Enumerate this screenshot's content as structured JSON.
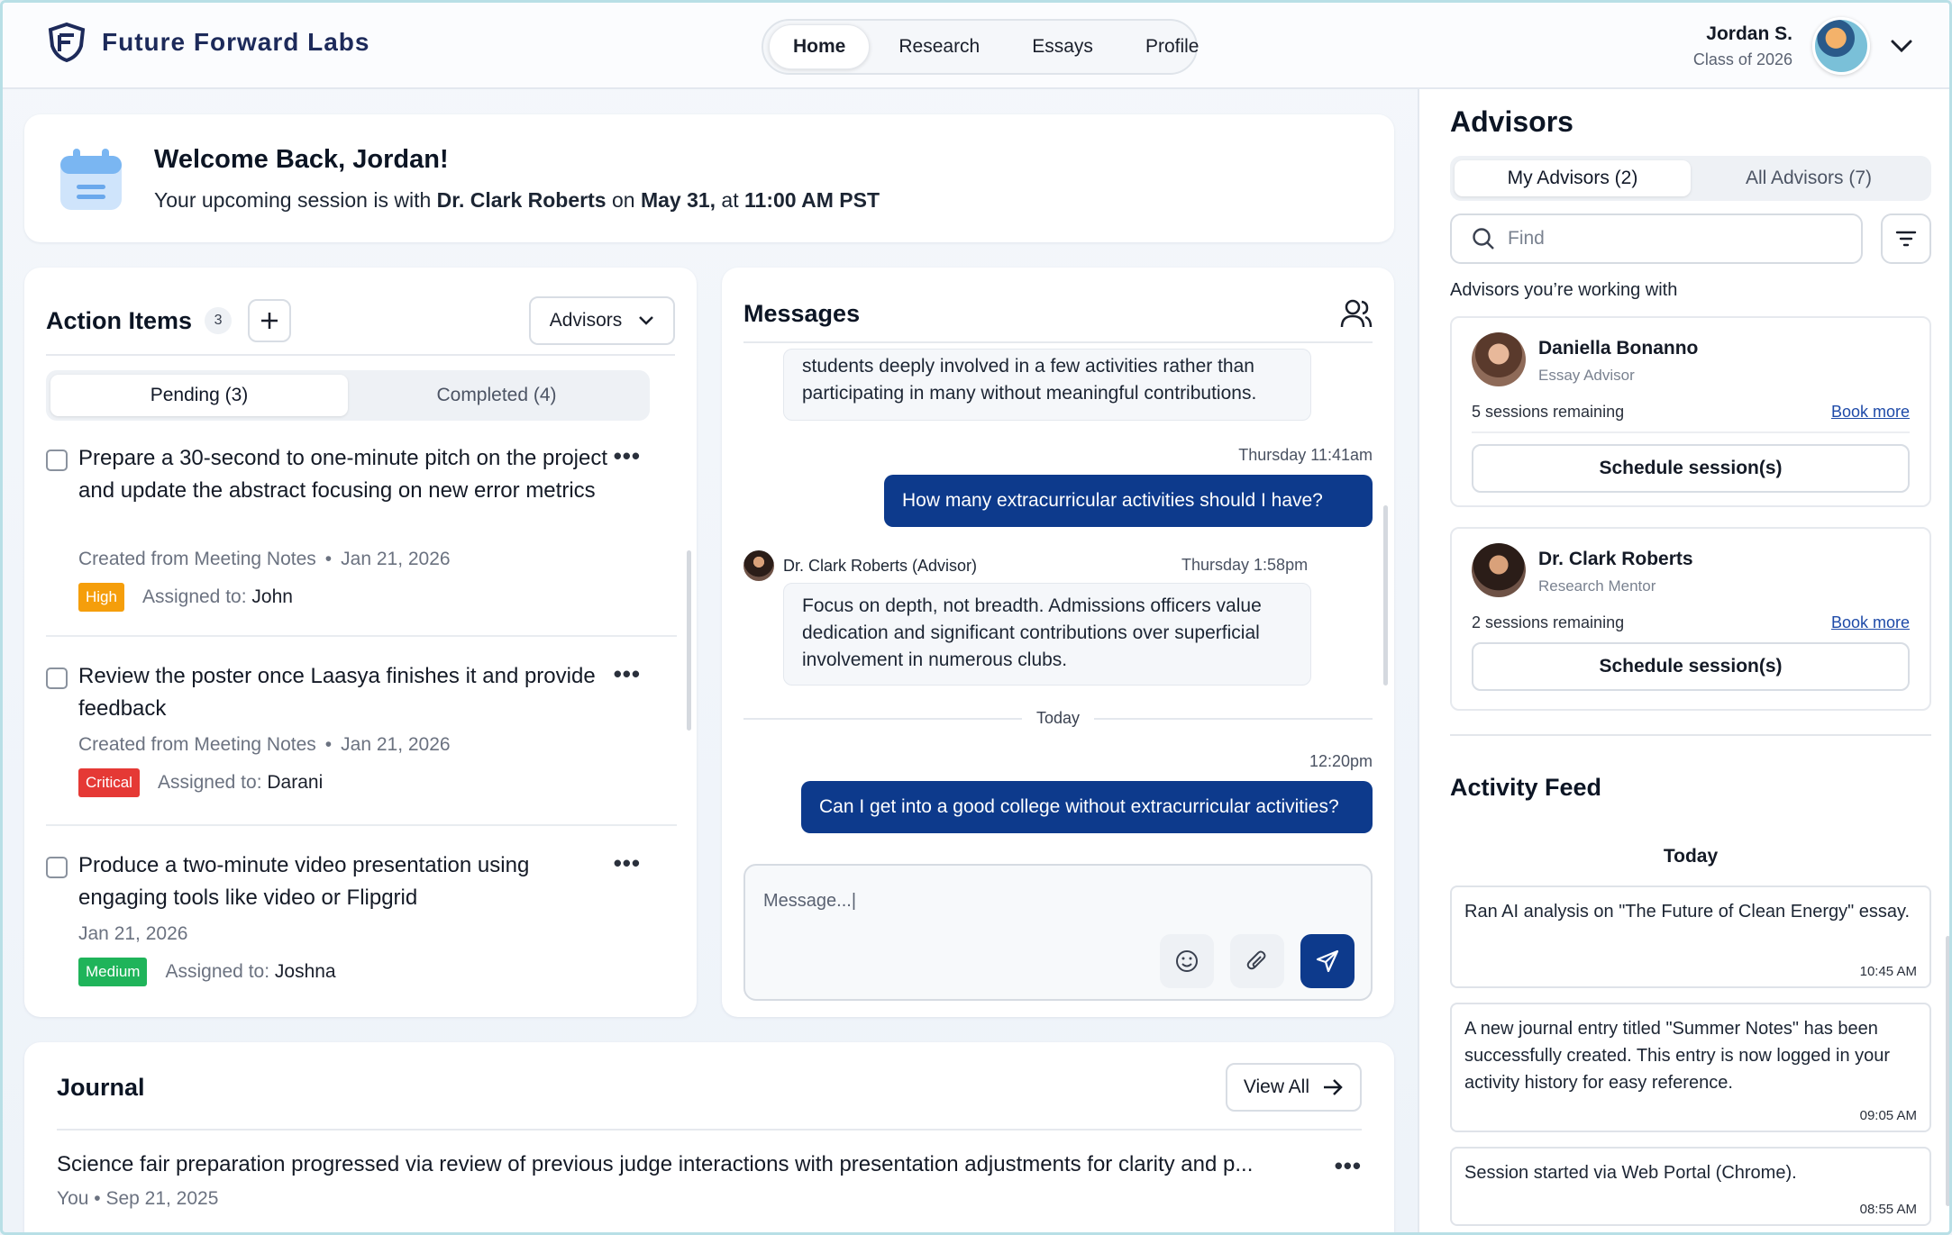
{
  "header": {
    "brand": "Future Forward Labs",
    "nav": [
      "Home",
      "Research",
      "Essays",
      "Profile"
    ],
    "active_nav": "Home",
    "user_name": "Jordan S.",
    "user_class": "Class of 2026"
  },
  "welcome": {
    "title": "Welcome Back, Jordan!",
    "sub_prefix": "Your upcoming session is with ",
    "advisor": "Dr. Clark Roberts",
    "sub_mid1": " on ",
    "date": "May 31,",
    "sub_mid2": " at ",
    "time": "11:00 AM PST"
  },
  "actions": {
    "title": "Action Items",
    "count": "3",
    "dropdown": "Advisors",
    "tabs": [
      "Pending (3)",
      "Completed (4)"
    ],
    "items": [
      {
        "title": "Prepare a 30-second to one-minute pitch on the project and update the abstract focusing on new error metrics",
        "source": "Created from Meeting Notes",
        "date": "Jan 21, 2026",
        "priority": "High",
        "assign_label": "Assigned to:",
        "assignee": "John"
      },
      {
        "title": "Review the poster once Laasya finishes it and provide feedback",
        "source": "Created from Meeting Notes",
        "date": "Jan 21, 2026",
        "priority": "Critical",
        "assign_label": "Assigned to:",
        "assignee": "Darani"
      },
      {
        "title": "Produce a two-minute video presentation using engaging tools like video or Flipgrid",
        "source": "",
        "date": "Jan 21, 2026",
        "priority": "Medium",
        "assign_label": "Assigned to:",
        "assignee": "Joshna"
      }
    ]
  },
  "messages": {
    "title": "Messages",
    "m1": "students deeply involved in a few activities rather than participating in many without meaningful contributions.",
    "m2_time": "Thursday 11:41am",
    "m2": "How many extracurricular activities should I have?",
    "m3_sender": "Dr. Clark Roberts (Advisor)",
    "m3_time": "Thursday 1:58pm",
    "m3": "Focus on depth, not breadth. Admissions officers value dedication and significant contributions over superficial involvement in numerous clubs.",
    "separator": "Today",
    "m4_time": "12:20pm",
    "m4": "Can I get into a good college without extracurricular activities?",
    "composer_placeholder": "Message...|"
  },
  "journal": {
    "title": "Journal",
    "view_all": "View All",
    "entry": "Science fair preparation progressed via review of previous judge interactions with presentation adjustments for clarity and p...",
    "meta": "You • Sep 21, 2025"
  },
  "advisors": {
    "title": "Advisors",
    "tabs": [
      "My Advisors (2)",
      "All Advisors (7)"
    ],
    "search_placeholder": "Find",
    "subtitle": "Advisors you’re working with",
    "list": [
      {
        "name": "Daniella Bonanno",
        "role": "Essay Advisor",
        "remaining": "5 sessions remaining",
        "link": "Book more",
        "button": "Schedule session(s)"
      },
      {
        "name": "Dr. Clark Roberts",
        "role": "Research Mentor",
        "remaining": "2 sessions remaining",
        "link": "Book more",
        "button": "Schedule session(s)"
      }
    ]
  },
  "feed": {
    "title": "Activity Feed",
    "day": "Today",
    "items": [
      {
        "text": "Ran AI analysis on \"The Future of Clean Energy\" essay.",
        "time": "10:45 AM"
      },
      {
        "text": "A new journal entry titled \"Summer Notes\" has been successfully created. This entry is now logged in your activity history for easy reference.",
        "time": "09:05 AM"
      },
      {
        "text": "Session started via Web Portal (Chrome).",
        "time": "08:55 AM"
      }
    ]
  },
  "colors": {
    "brand": "#0d3a8c",
    "high": "#f59e0b",
    "critical": "#e53935",
    "medium": "#1fb45a"
  }
}
